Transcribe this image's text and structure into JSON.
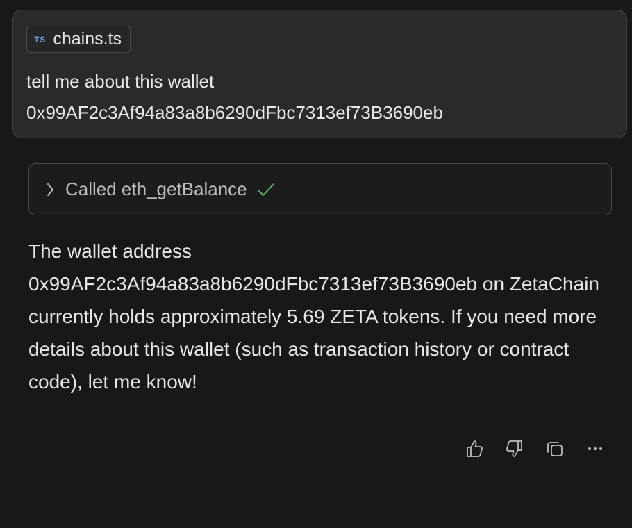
{
  "user_message": {
    "attachment": {
      "icon": "typescript-file-icon",
      "badge": "TS",
      "filename": "chains.ts"
    },
    "text": "tell me about this wallet 0x99AF2c3Af94a83a8b6290dFbc7313ef73B3690eb"
  },
  "tool_call": {
    "label": "Called eth_getBalance",
    "status_icon": "checkmark-icon",
    "status_color": "#5cae6b"
  },
  "assistant_response": {
    "text": "The wallet address 0x99AF2c3Af94a83a8b6290dFbc7313ef73B3690eb on ZetaChain currently holds approximately 5.69 ZETA tokens. If you need more details about this wallet (such as transaction history or contract code), let me know!"
  },
  "actions": [
    {
      "name": "thumbs-up-icon"
    },
    {
      "name": "thumbs-down-icon"
    },
    {
      "name": "copy-icon"
    },
    {
      "name": "more-options-icon"
    }
  ]
}
